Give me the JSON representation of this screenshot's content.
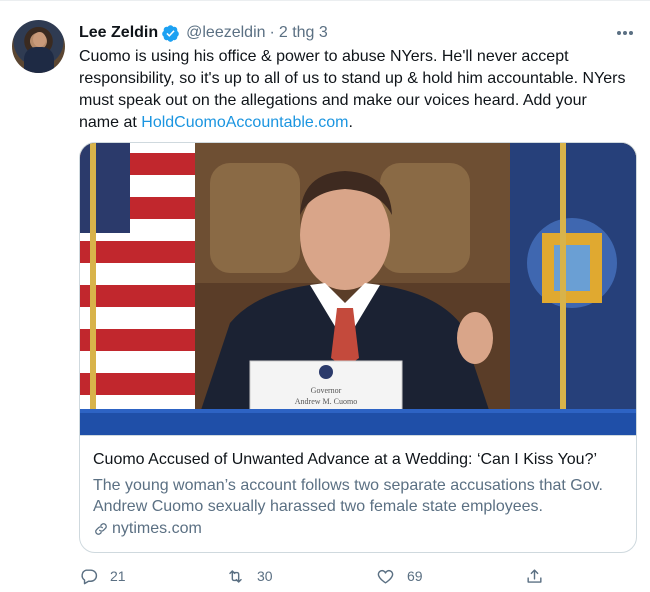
{
  "tweet": {
    "author_name": "Lee Zeldin",
    "author_handle": "@leezeldin",
    "separator": "·",
    "timestamp": "2 thg 3",
    "text_before_link": "Cuomo is using his office & power to abuse NYers. He'll never accept responsibility, so it's up to all of us to stand up & hold him accountable. NYers must speak out on the allegations and make our voices heard. Add your name at ",
    "link_text": "HoldCuomoAccountable.com",
    "text_after_link": "."
  },
  "card": {
    "nameplate_line1": "Governor",
    "nameplate_line2": "Andrew M. Cuomo",
    "title": "Cuomo Accused of Unwanted Advance at a Wedding: ‘Can I Kiss You?’",
    "description": "The young woman’s account follows two separate accusations that Gov. Andrew Cuomo sexually harassed two female state employees.",
    "domain": "nytimes.com"
  },
  "actions": {
    "reply_count": "21",
    "retweet_count": "30",
    "like_count": "69"
  },
  "colors": {
    "accent": "#1b95e0",
    "secondary_text": "#5b7083",
    "verified": "#1da1f2",
    "border": "#cfd9de"
  },
  "icons": [
    "verified-badge-icon",
    "more-icon",
    "link-icon",
    "reply-icon",
    "retweet-icon",
    "like-icon",
    "share-icon"
  ]
}
